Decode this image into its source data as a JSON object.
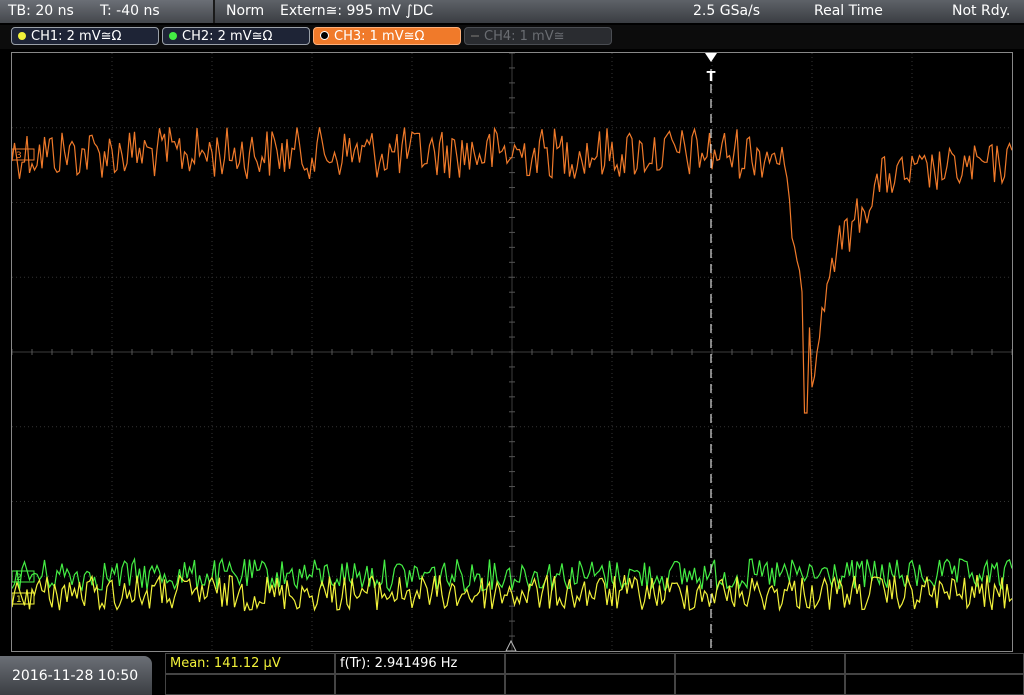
{
  "status": {
    "tb": "TB: 20 ns",
    "t": "T: -40 ns",
    "mode": "Norm",
    "trigger": "Extern≅: 995 mV ∫DC",
    "rate": "2.5 GSa/s",
    "acq": "Real Time",
    "state": "Not Rdy."
  },
  "channels": [
    {
      "label": "CH1: 2 mV≅Ω",
      "color": "#f2f23a"
    },
    {
      "label": "CH2: 2 mV≅Ω",
      "color": "#44ee44"
    },
    {
      "label": "CH3: 1 mV≅Ω",
      "color": "#f07a2a"
    },
    {
      "label": "CH4: 1 mV≅",
      "color": "#6a6d72"
    }
  ],
  "markers": {
    "trigger": "T",
    "ch3": "3",
    "ch2": "2",
    "ch1": "1"
  },
  "footer": {
    "datetime": "2016-11-28 10:50",
    "mean": "Mean: 141.12 µV",
    "freq": "f(Tr): 2.941496 Hz"
  },
  "colors": {
    "ch1": "#f2f23a",
    "ch2": "#44ee44",
    "ch3": "#f07a2a",
    "grid": "#3a3a3a"
  }
}
